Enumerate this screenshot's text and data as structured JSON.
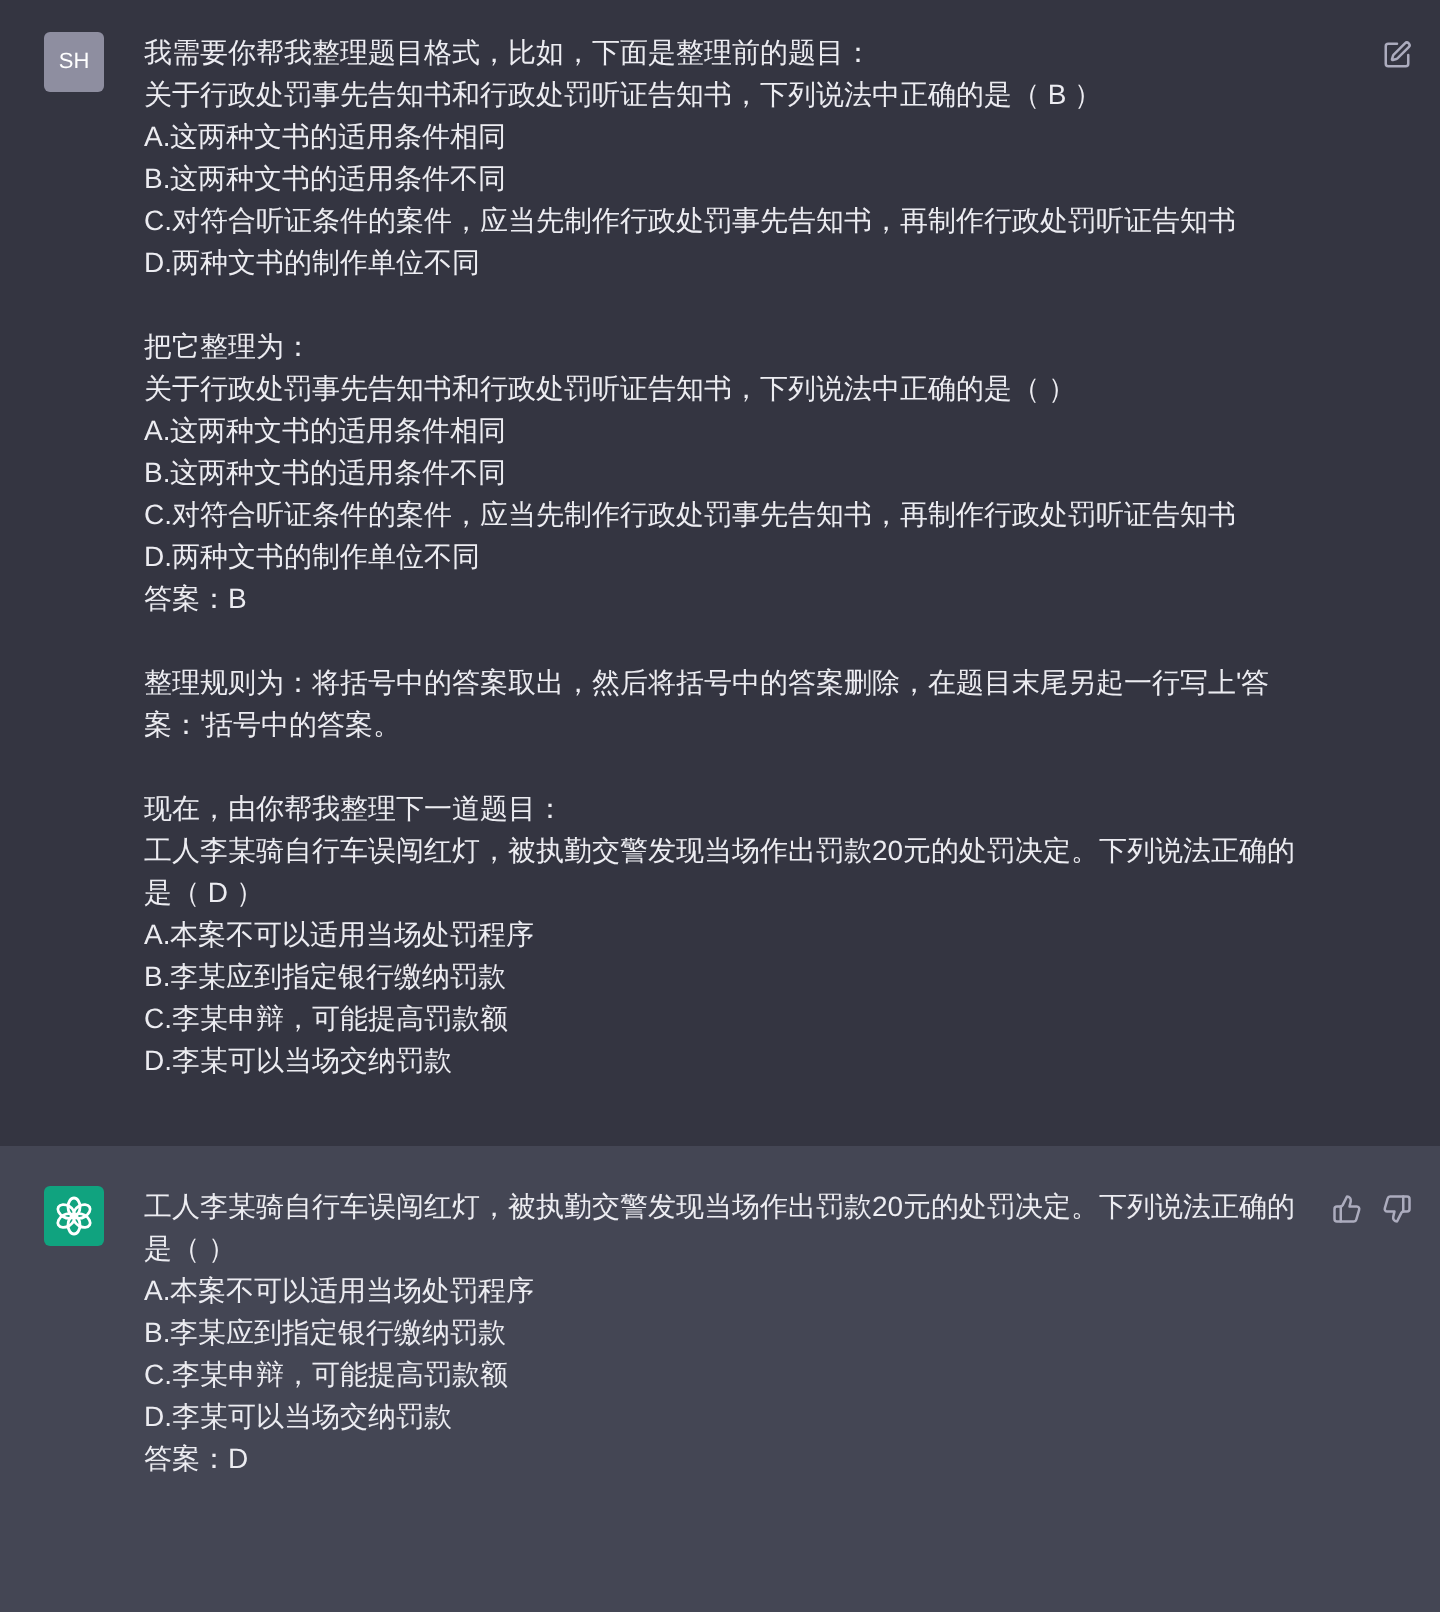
{
  "messages": [
    {
      "kind": "user",
      "avatar": "SH",
      "paragraphs": [
        [
          "我需要你帮我整理题目格式，比如，下面是整理前的题目：",
          "关于行政处罚事先告知书和行政处罚听证告知书，下列说法中正确的是（ B ）",
          "A.这两种文书的适用条件相同",
          "B.这两种文书的适用条件不同",
          "C.对符合听证条件的案件，应当先制作行政处罚事先告知书，再制作行政处罚听证告知书",
          "D.两种文书的制作单位不同"
        ],
        [
          "把它整理为：",
          "关于行政处罚事先告知书和行政处罚听证告知书，下列说法中正确的是（ ）",
          "A.这两种文书的适用条件相同",
          "B.这两种文书的适用条件不同",
          "C.对符合听证条件的案件，应当先制作行政处罚事先告知书，再制作行政处罚听证告知书",
          "D.两种文书的制作单位不同",
          "答案：B"
        ],
        [
          "整理规则为：将括号中的答案取出，然后将括号中的答案删除，在题目末尾另起一行写上'答案：'括号中的答案。"
        ],
        [
          "现在，由你帮我整理下一道题目：",
          "工人李某骑自行车误闯红灯，被执勤交警发现当场作出罚款20元的处罚决定。下列说法正确的是（ D ）",
          "A.本案不可以适用当场处罚程序",
          "B.李某应到指定银行缴纳罚款",
          "C.李某申辩，可能提高罚款额",
          "D.李某可以当场交纳罚款"
        ]
      ]
    },
    {
      "kind": "assistant",
      "paragraphs": [
        [
          "工人李某骑自行车误闯红灯，被执勤交警发现当场作出罚款20元的处罚决定。下列说法正确的是（ ）",
          "A.本案不可以适用当场处罚程序",
          "B.李某应到指定银行缴纳罚款",
          "C.李某申辩，可能提高罚款额",
          "D.李某可以当场交纳罚款",
          "答案：D"
        ]
      ]
    }
  ]
}
